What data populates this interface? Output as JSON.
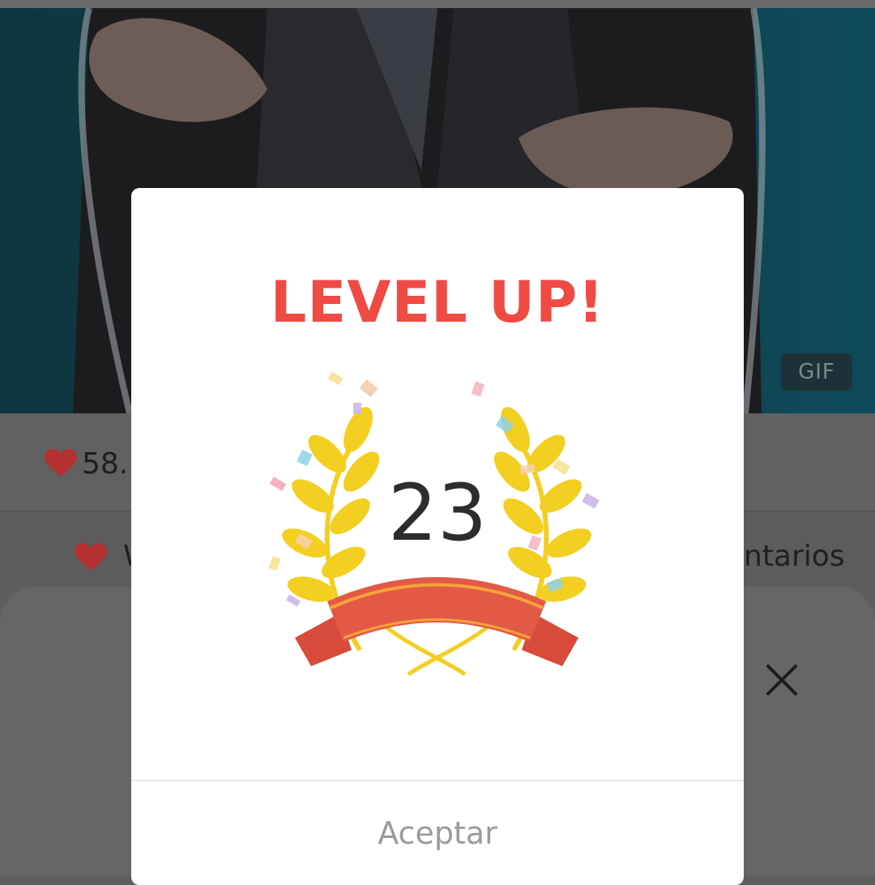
{
  "media": {
    "badge": "GIF"
  },
  "stats": {
    "likes": "58."
  },
  "actions": {
    "like_label": "W",
    "comments_label": "ntarios"
  },
  "dialog": {
    "title": "LEVEL UP!",
    "level": "23",
    "accept_label": "Aceptar"
  },
  "colors": {
    "title": "#f04a45",
    "laurel": "#f2cf21",
    "ribbon": "#e25a45",
    "heart": "#e53935"
  },
  "icons": {
    "heart": "heart-icon",
    "close": "close-icon",
    "laurel": "laurel-wreath-icon"
  }
}
